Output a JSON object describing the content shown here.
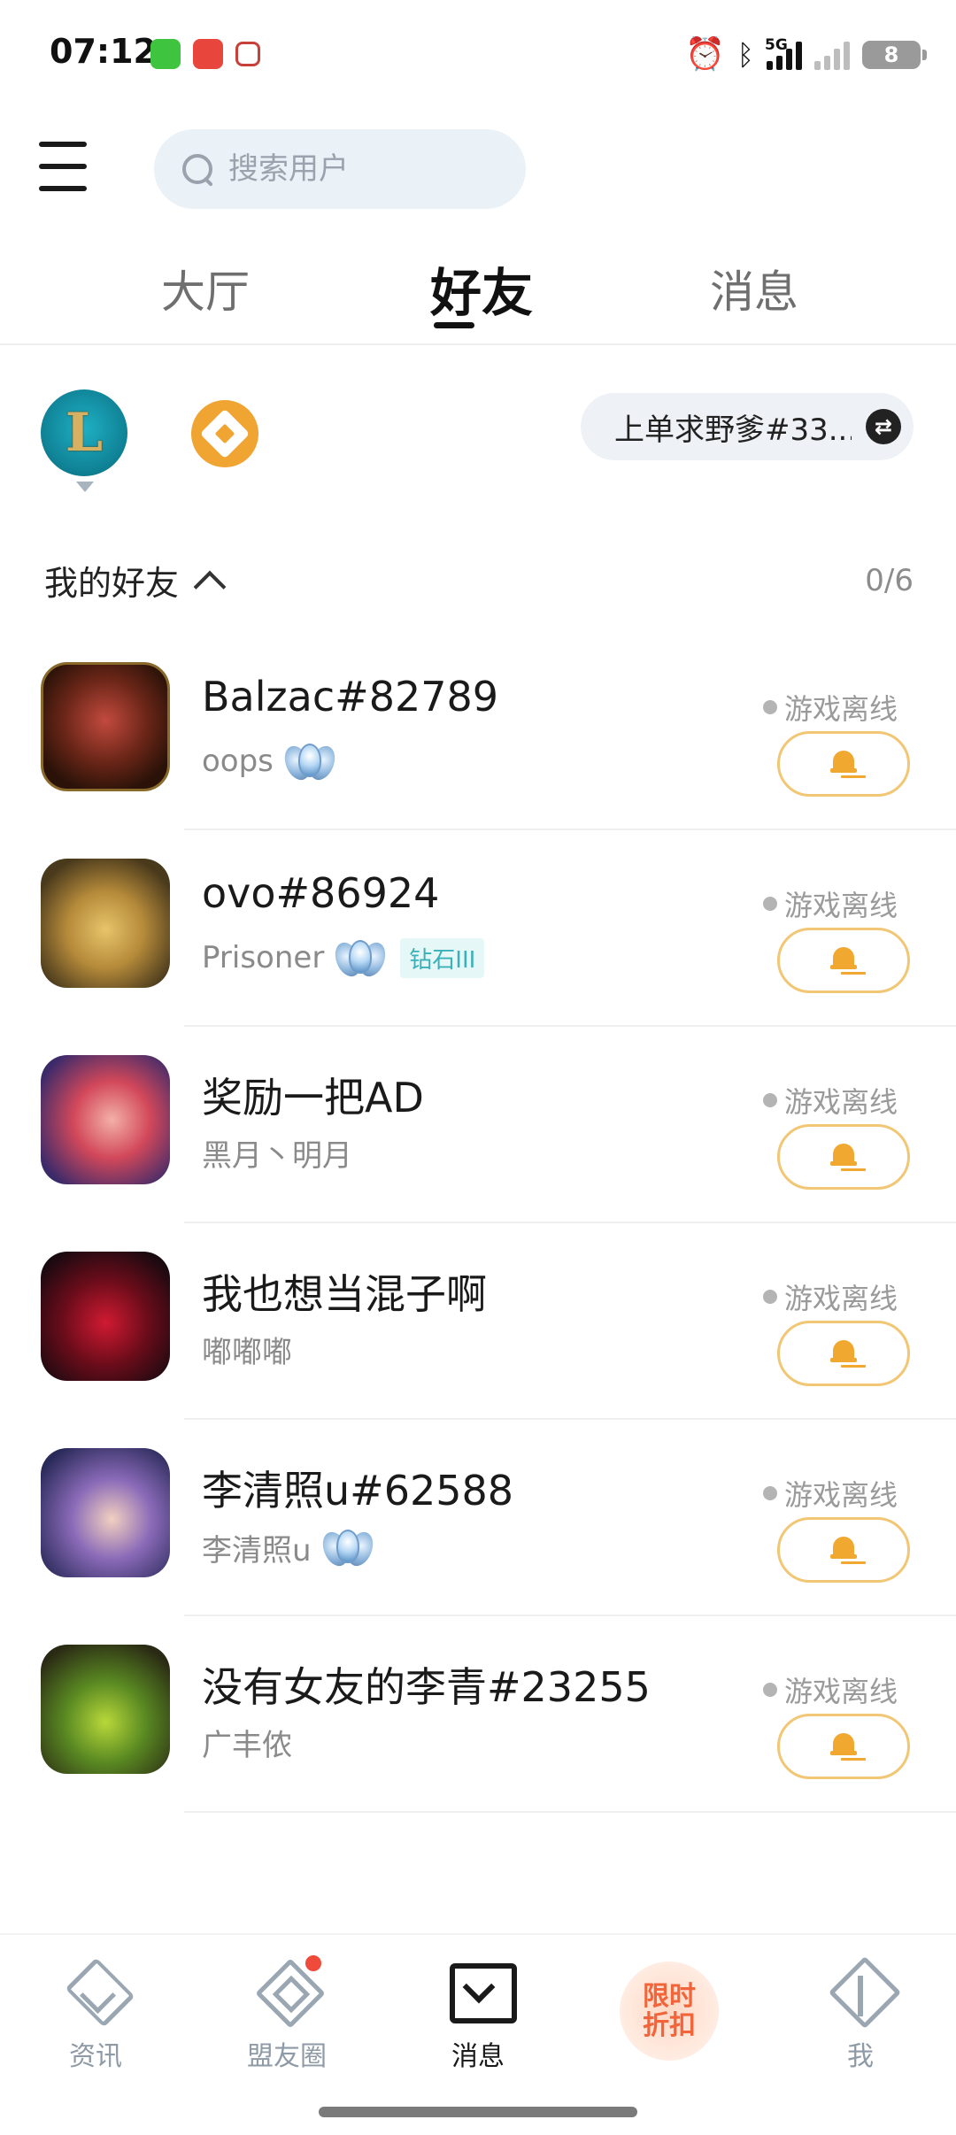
{
  "status_bar": {
    "time": "07:12",
    "network": "5G",
    "battery": "8",
    "icons": [
      "messages-app-icon",
      "app-618-icon",
      "app-icon",
      "alarm-icon",
      "bluetooth-icon",
      "signal-icon",
      "no-signal-icon",
      "battery-icon"
    ]
  },
  "header": {
    "menu_icon": "hamburger-menu-icon",
    "search": {
      "placeholder": "搜索用户",
      "value": ""
    }
  },
  "tabs": [
    {
      "label": "大厅",
      "active": false
    },
    {
      "label": "好友",
      "active": true
    },
    {
      "label": "消息",
      "active": false
    }
  ],
  "games": {
    "items": [
      "league-of-legends-icon",
      "tft-icon"
    ],
    "selected": "league-of-legends-icon",
    "lol_letter": "L",
    "account": "上单求野爹#33...",
    "swap_icon": "⇄"
  },
  "friends_section": {
    "title": "我的好友",
    "count": "0/6",
    "friends": [
      {
        "name": "Balzac#82789",
        "sub": "oops",
        "rank_badge": true,
        "rank_tag": "",
        "status": "游戏离线"
      },
      {
        "name": "ovo#86924",
        "sub": "Prisoner",
        "rank_badge": true,
        "rank_tag": "钻石III",
        "status": "游戏离线"
      },
      {
        "name": "奖励一把AD",
        "sub": "黑月丶明月",
        "rank_badge": false,
        "rank_tag": "",
        "status": "游戏离线"
      },
      {
        "name": "我也想当混子啊",
        "sub": "嘟嘟嘟",
        "rank_badge": false,
        "rank_tag": "",
        "status": "游戏离线"
      },
      {
        "name": "李清照u#62588",
        "sub": "李清照u",
        "rank_badge": true,
        "rank_tag": "",
        "status": "游戏离线"
      },
      {
        "name": "没有女友的李青#23255",
        "sub": "广丰侬",
        "rank_badge": false,
        "rank_tag": "",
        "status": "游戏离线"
      }
    ]
  },
  "bottom_nav": {
    "items": [
      {
        "label": "资讯",
        "icon": "news-icon",
        "active": false
      },
      {
        "label": "盟友圈",
        "icon": "circle-icon",
        "active": false,
        "badge_dot": true
      },
      {
        "label": "消息",
        "icon": "message-icon",
        "active": true
      },
      {
        "label": "限时折扣",
        "icon": "promo-icon",
        "active": false
      },
      {
        "label": "我",
        "icon": "profile-icon",
        "active": false
      }
    ],
    "promo_line1": "限时",
    "promo_line2": "折扣"
  },
  "colors": {
    "accent_gold": "#f0a830",
    "search_bg": "#eaf1f7",
    "rank_tag": "#3bb0b8",
    "badge_red": "#f04a3a",
    "promo": "#f2643a"
  }
}
